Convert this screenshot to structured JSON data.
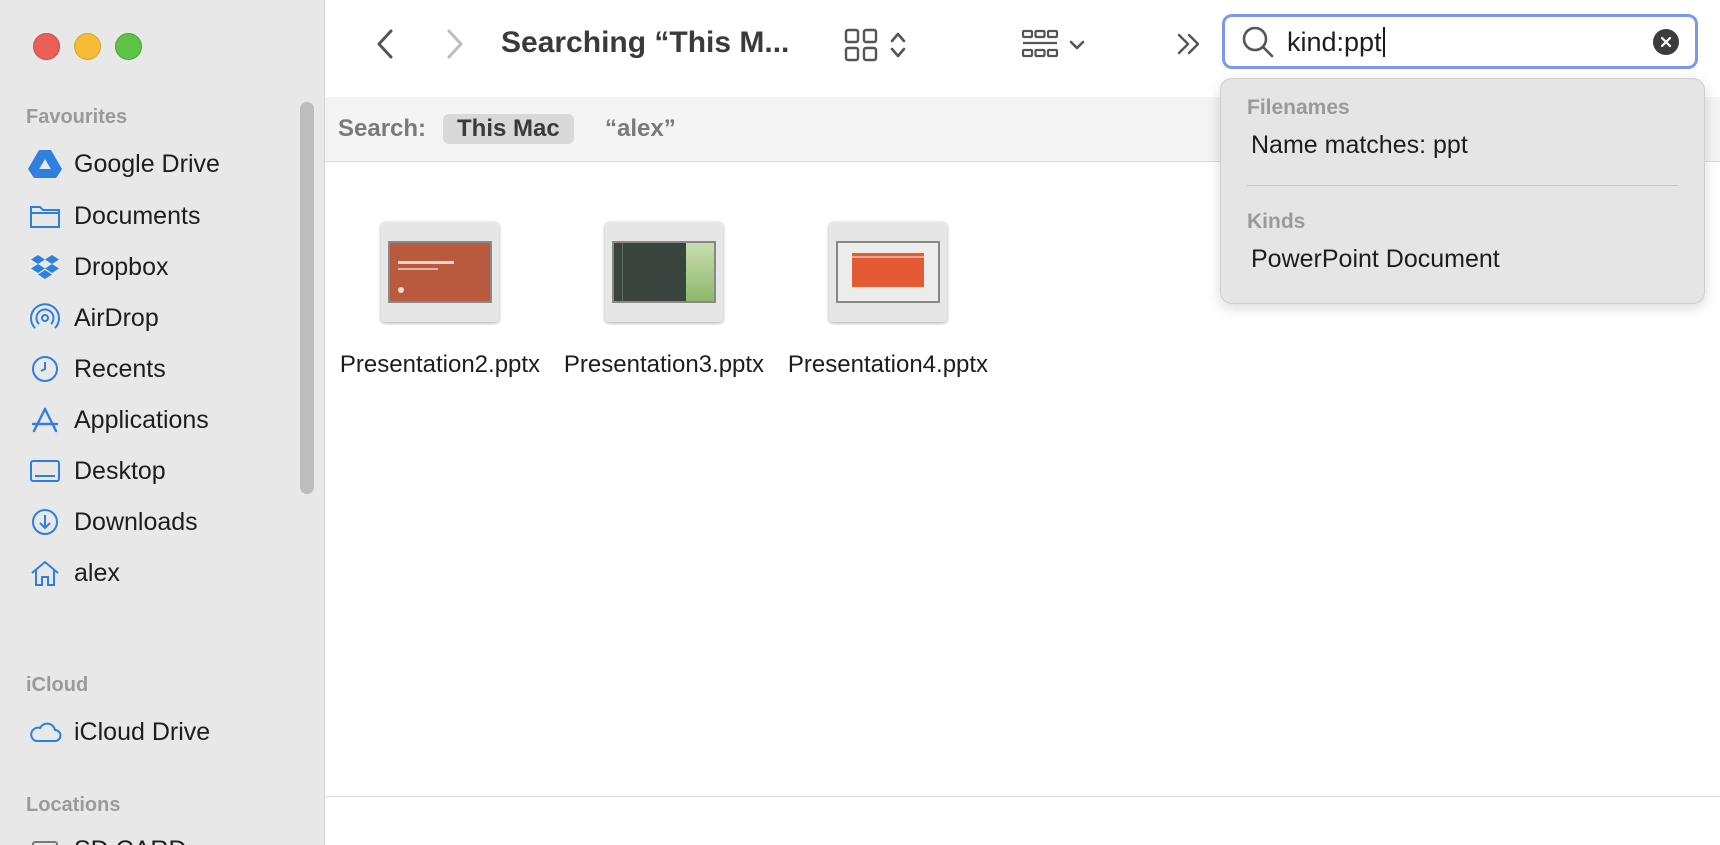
{
  "sidebar": {
    "sections": {
      "favourites": "Favourites",
      "icloud": "iCloud",
      "locations": "Locations"
    },
    "favourites": [
      {
        "label": "Google Drive",
        "icon": "google-drive-icon"
      },
      {
        "label": "Documents",
        "icon": "folder-icon"
      },
      {
        "label": "Dropbox",
        "icon": "dropbox-icon"
      },
      {
        "label": "AirDrop",
        "icon": "airdrop-icon"
      },
      {
        "label": "Recents",
        "icon": "clock-icon"
      },
      {
        "label": "Applications",
        "icon": "applications-icon"
      },
      {
        "label": "Desktop",
        "icon": "desktop-icon"
      },
      {
        "label": "Downloads",
        "icon": "download-icon"
      },
      {
        "label": "alex",
        "icon": "home-icon"
      }
    ],
    "icloud": [
      {
        "label": "iCloud Drive",
        "icon": "cloud-icon"
      }
    ],
    "locations": [
      {
        "label": "SD CARD",
        "icon": "drive-icon"
      }
    ]
  },
  "toolbar": {
    "title": "Searching “This M...",
    "search_value": "kind:ppt"
  },
  "scope": {
    "label": "Search:",
    "selected": "This Mac",
    "other": "“alex”"
  },
  "files": [
    {
      "name": "Presentation2.pptx"
    },
    {
      "name": "Presentation3.pptx"
    },
    {
      "name": "Presentation4.pptx"
    }
  ],
  "dropdown": {
    "filenames_header": "Filenames",
    "filenames_item": "Name matches: ppt",
    "kinds_header": "Kinds",
    "kinds_item": "PowerPoint Document"
  },
  "colors": {
    "accent": "#2f7fe0",
    "search_focus": "#7d97ea"
  }
}
